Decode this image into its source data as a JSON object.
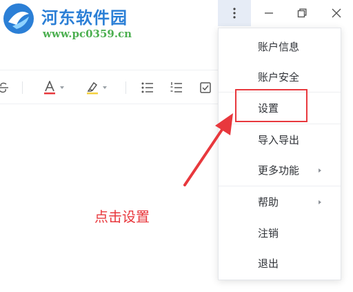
{
  "watermark": {
    "title": "河东软件园",
    "url": "www.pc0359.cn"
  },
  "menu": {
    "items": [
      {
        "label": "账户信息",
        "has_submenu": false
      },
      {
        "label": "账户安全",
        "has_submenu": false
      },
      {
        "label": "设置",
        "has_submenu": false
      },
      {
        "label": "导入导出",
        "has_submenu": false
      },
      {
        "label": "更多功能",
        "has_submenu": true
      },
      {
        "label": "帮助",
        "has_submenu": true
      },
      {
        "label": "注销",
        "has_submenu": false
      },
      {
        "label": "退出",
        "has_submenu": false
      }
    ]
  },
  "annotation": {
    "callout": "点击设置",
    "color": "#e8383d"
  },
  "colors": {
    "menu_button_bg": "#e6ecf6",
    "text_color_icon_underline": "#e8383d",
    "highlight_icon_fill": "#f4d03f"
  }
}
